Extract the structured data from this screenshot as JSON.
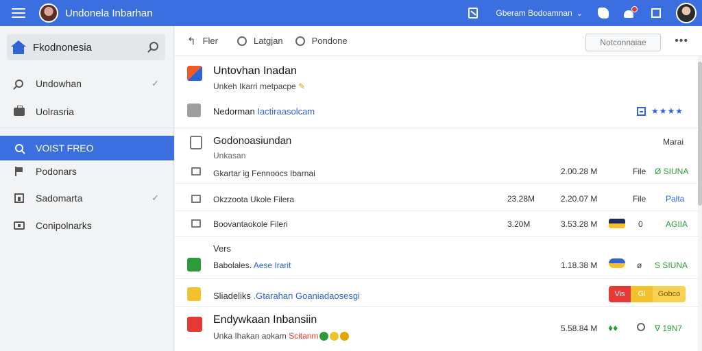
{
  "header": {
    "app_title": "Undonela Inbarhan",
    "account_name": "Gberam Bodoamnan",
    "icons": [
      "menu-icon",
      "document-icon",
      "chevron-down-icon",
      "puzzle-icon",
      "notification-icon",
      "window-icon",
      "avatar"
    ]
  },
  "sidebar": {
    "search_title": "Fkodnonesia",
    "items": [
      {
        "label": "Undowhan",
        "icon": "search-icon",
        "check": "✓"
      },
      {
        "label": "Uolrasria",
        "icon": "briefcase-icon",
        "check": ""
      },
      {
        "label": "VOIST FREO",
        "icon": "search-icon",
        "check": "",
        "active": true
      },
      {
        "label": "Podonars",
        "icon": "flag-icon",
        "check": ""
      },
      {
        "label": "Sadomarta",
        "icon": "chart-icon",
        "check": "✓"
      },
      {
        "label": "Conipolnarks",
        "icon": "folder-icon",
        "check": ""
      }
    ]
  },
  "toolbar": {
    "back": "↰",
    "filter_label": "Fler",
    "option1_label": "Latgjan",
    "option2_label": "Pondone",
    "action_button": "Notconnaiae",
    "more": "•••"
  },
  "content": {
    "card1": {
      "title": "Untovhan Inadan",
      "subtitle": "Unkeh Ikarri metpacpe"
    },
    "row_medoman": {
      "name": "Nedorman",
      "link": "Iactiraasolcam",
      "stars": "★★★★"
    },
    "section": {
      "title": "Godonoasiundan",
      "subtitle": "Unkasan",
      "right": "Marai"
    },
    "rows": [
      {
        "name": "Gkartar ig Fennoocs Ibarnai",
        "size": "",
        "date": "2.00.28 M",
        "type": "File",
        "status": "Ø SIUNA"
      },
      {
        "name": "Okzzoota Ukole Filera",
        "size": "23.28M",
        "date": "2.20.07 M",
        "type": "File",
        "status": "Palta"
      },
      {
        "name": "Boovantaokole Fileri",
        "size": "3.20M",
        "date": "3.53.28 M",
        "type": "0",
        "status": "AGIIA"
      }
    ],
    "vers_label": "Vers",
    "row_babolales": {
      "name": "Babolales.",
      "link": "Aese Irarit",
      "date": "1.18.38 M",
      "type": "ø",
      "status": "S SIUNA"
    },
    "row_sliadeliks": {
      "name": "Sliadeliks",
      "link": ".Gtarahan Goaniadaosesgi",
      "pill1": "Vis",
      "pill2": "Gl",
      "pill3": "Gobco"
    },
    "card2": {
      "title": "Endywkaan Inbansiin",
      "subtitle": "Unka Ihakan aokam",
      "badge": "Scitanm",
      "date": "5.58.84 M",
      "status": "∇ 19N7"
    }
  },
  "colors": {
    "accent": "#3b6fe0",
    "green": "#2e9b3a",
    "red": "#e53935",
    "yellow": "#f2c12e"
  }
}
